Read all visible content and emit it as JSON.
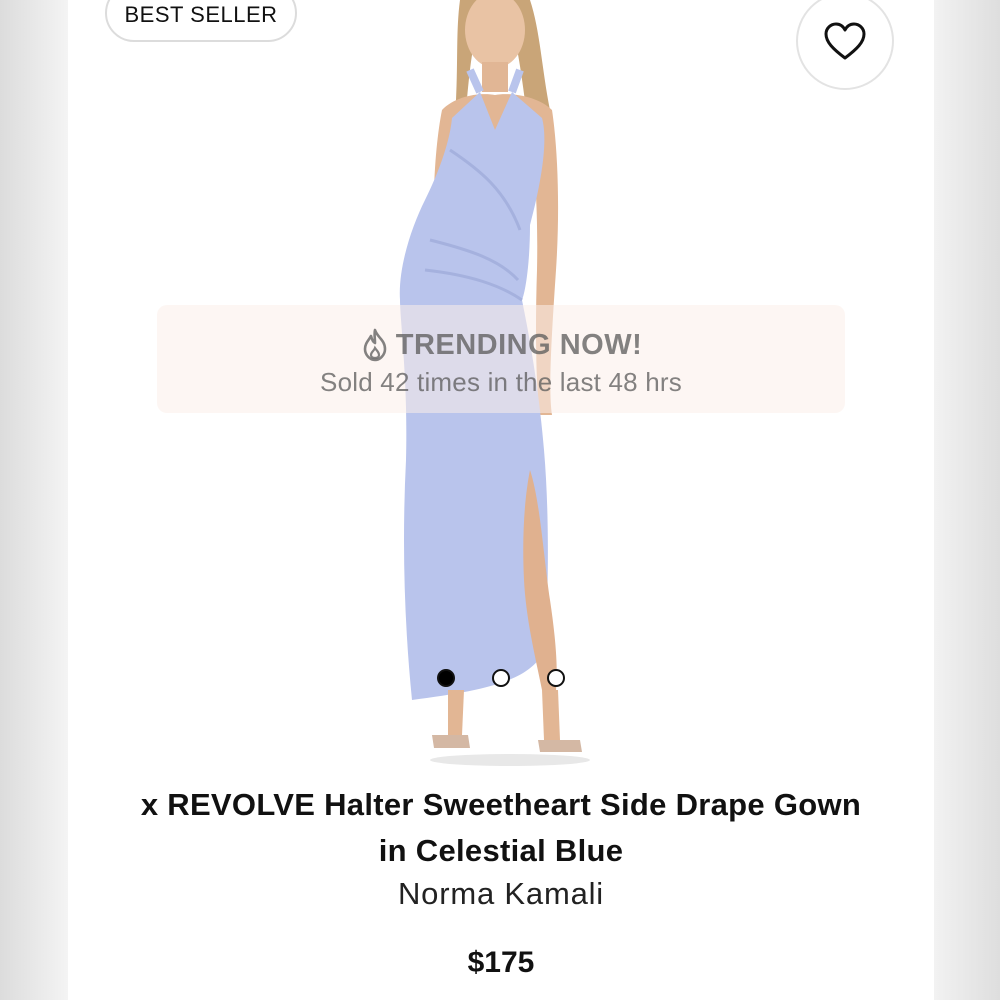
{
  "badge": {
    "label": "BEST SELLER"
  },
  "wishlist": {
    "icon": "heart-outline-icon"
  },
  "trending": {
    "icon": "flame-icon",
    "heading": "TRENDING NOW!",
    "subtext": "Sold 42 times in the last 48 hrs"
  },
  "carousel": {
    "total": 3,
    "active_index": 1
  },
  "product": {
    "title_line1": "x REVOLVE Halter Sweetheart Side Drape Gown",
    "title_line2": "in Celestial Blue",
    "brand": "Norma Kamali",
    "price": "$175",
    "dress_color": "#b9c4ec"
  }
}
